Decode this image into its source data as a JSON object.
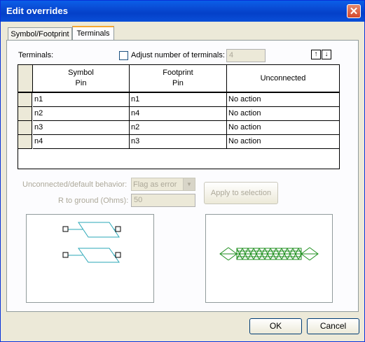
{
  "window": {
    "title": "Edit overrides",
    "close_icon": "close-icon"
  },
  "tabs": [
    {
      "label": "Symbol/Footprint"
    },
    {
      "label": "Terminals"
    }
  ],
  "terminals": {
    "label": "Terminals:",
    "adjust_label": "Adjust number of terminals:",
    "adjust_checked": false,
    "adjust_value": "4",
    "reorder_icon": "up-down-arrows-icon"
  },
  "grid": {
    "headers": [
      {
        "line1": "Symbol",
        "line2": "Pin"
      },
      {
        "line1": "Footprint",
        "line2": "Pin"
      },
      {
        "line1": "Unconnected",
        "line2": ""
      }
    ],
    "rows": [
      [
        "n1",
        "n1",
        "No action"
      ],
      [
        "n2",
        "n4",
        "No action"
      ],
      [
        "n3",
        "n2",
        "No action"
      ],
      [
        "n4",
        "n3",
        "No action"
      ]
    ]
  },
  "behavior": {
    "unconnected_label": "Unconnected/default behavior:",
    "unconnected_value": "Flag as error",
    "r_label": "R to ground (Ohms):",
    "r_value": "50",
    "apply_label": "Apply to selection"
  },
  "buttons": {
    "ok": "OK",
    "cancel": "Cancel"
  },
  "colors": {
    "title_bar": "#0a4fd8",
    "symbol_stroke": "#2aa7b7",
    "footprint_stroke": "#1f8f1f",
    "dialog_bg": "#ece9d8"
  }
}
